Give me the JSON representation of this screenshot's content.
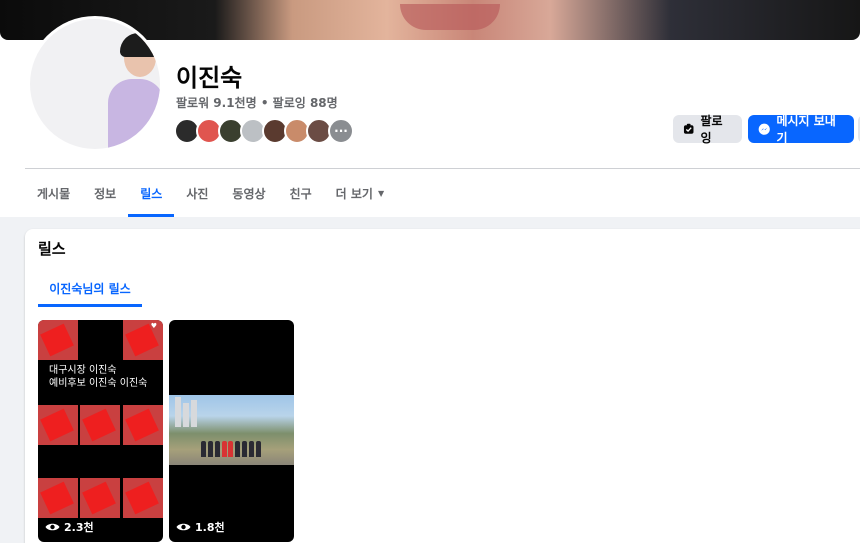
{
  "profile": {
    "name": "이진숙",
    "stats": "팔로워 9.1천명 • 팔로잉 88명"
  },
  "friend_avatars": [
    {
      "icon": "friend-avatar-icon",
      "color": "#2b2b2b"
    },
    {
      "icon": "friend-avatar-icon",
      "color": "#e0554f"
    },
    {
      "icon": "friend-avatar-icon",
      "color": "#3a3f2f"
    },
    {
      "icon": "friend-avatar-icon",
      "color": "#bcc0c4"
    },
    {
      "icon": "friend-avatar-icon",
      "color": "#5a3a2f"
    },
    {
      "icon": "friend-avatar-icon",
      "color": "#c98b6a"
    },
    {
      "icon": "friend-avatar-icon",
      "color": "#6b4c44"
    },
    {
      "icon": "more-icon",
      "color": "#8a8d91",
      "label": "···"
    }
  ],
  "actions": {
    "follow_label": "팔로잉",
    "message_label": "메시지 보내기"
  },
  "tabs": [
    {
      "label": "게시물",
      "active": false
    },
    {
      "label": "정보",
      "active": false
    },
    {
      "label": "릴스",
      "active": true
    },
    {
      "label": "사진",
      "active": false
    },
    {
      "label": "동영상",
      "active": false
    },
    {
      "label": "친구",
      "active": false
    },
    {
      "label": "더 보기",
      "active": false
    }
  ],
  "reels_section": {
    "title": "릴스",
    "subtab": "이진숙님의 릴스",
    "items": [
      {
        "caption": "대구시장 이진숙\n예비후보 이진숙 이진숙",
        "views": "2.3천"
      },
      {
        "caption": "",
        "views": "1.8천"
      }
    ]
  },
  "colors": {
    "accent": "#0866ff",
    "page_background": "#f0f2f5",
    "secondary_text": "#65676b"
  }
}
